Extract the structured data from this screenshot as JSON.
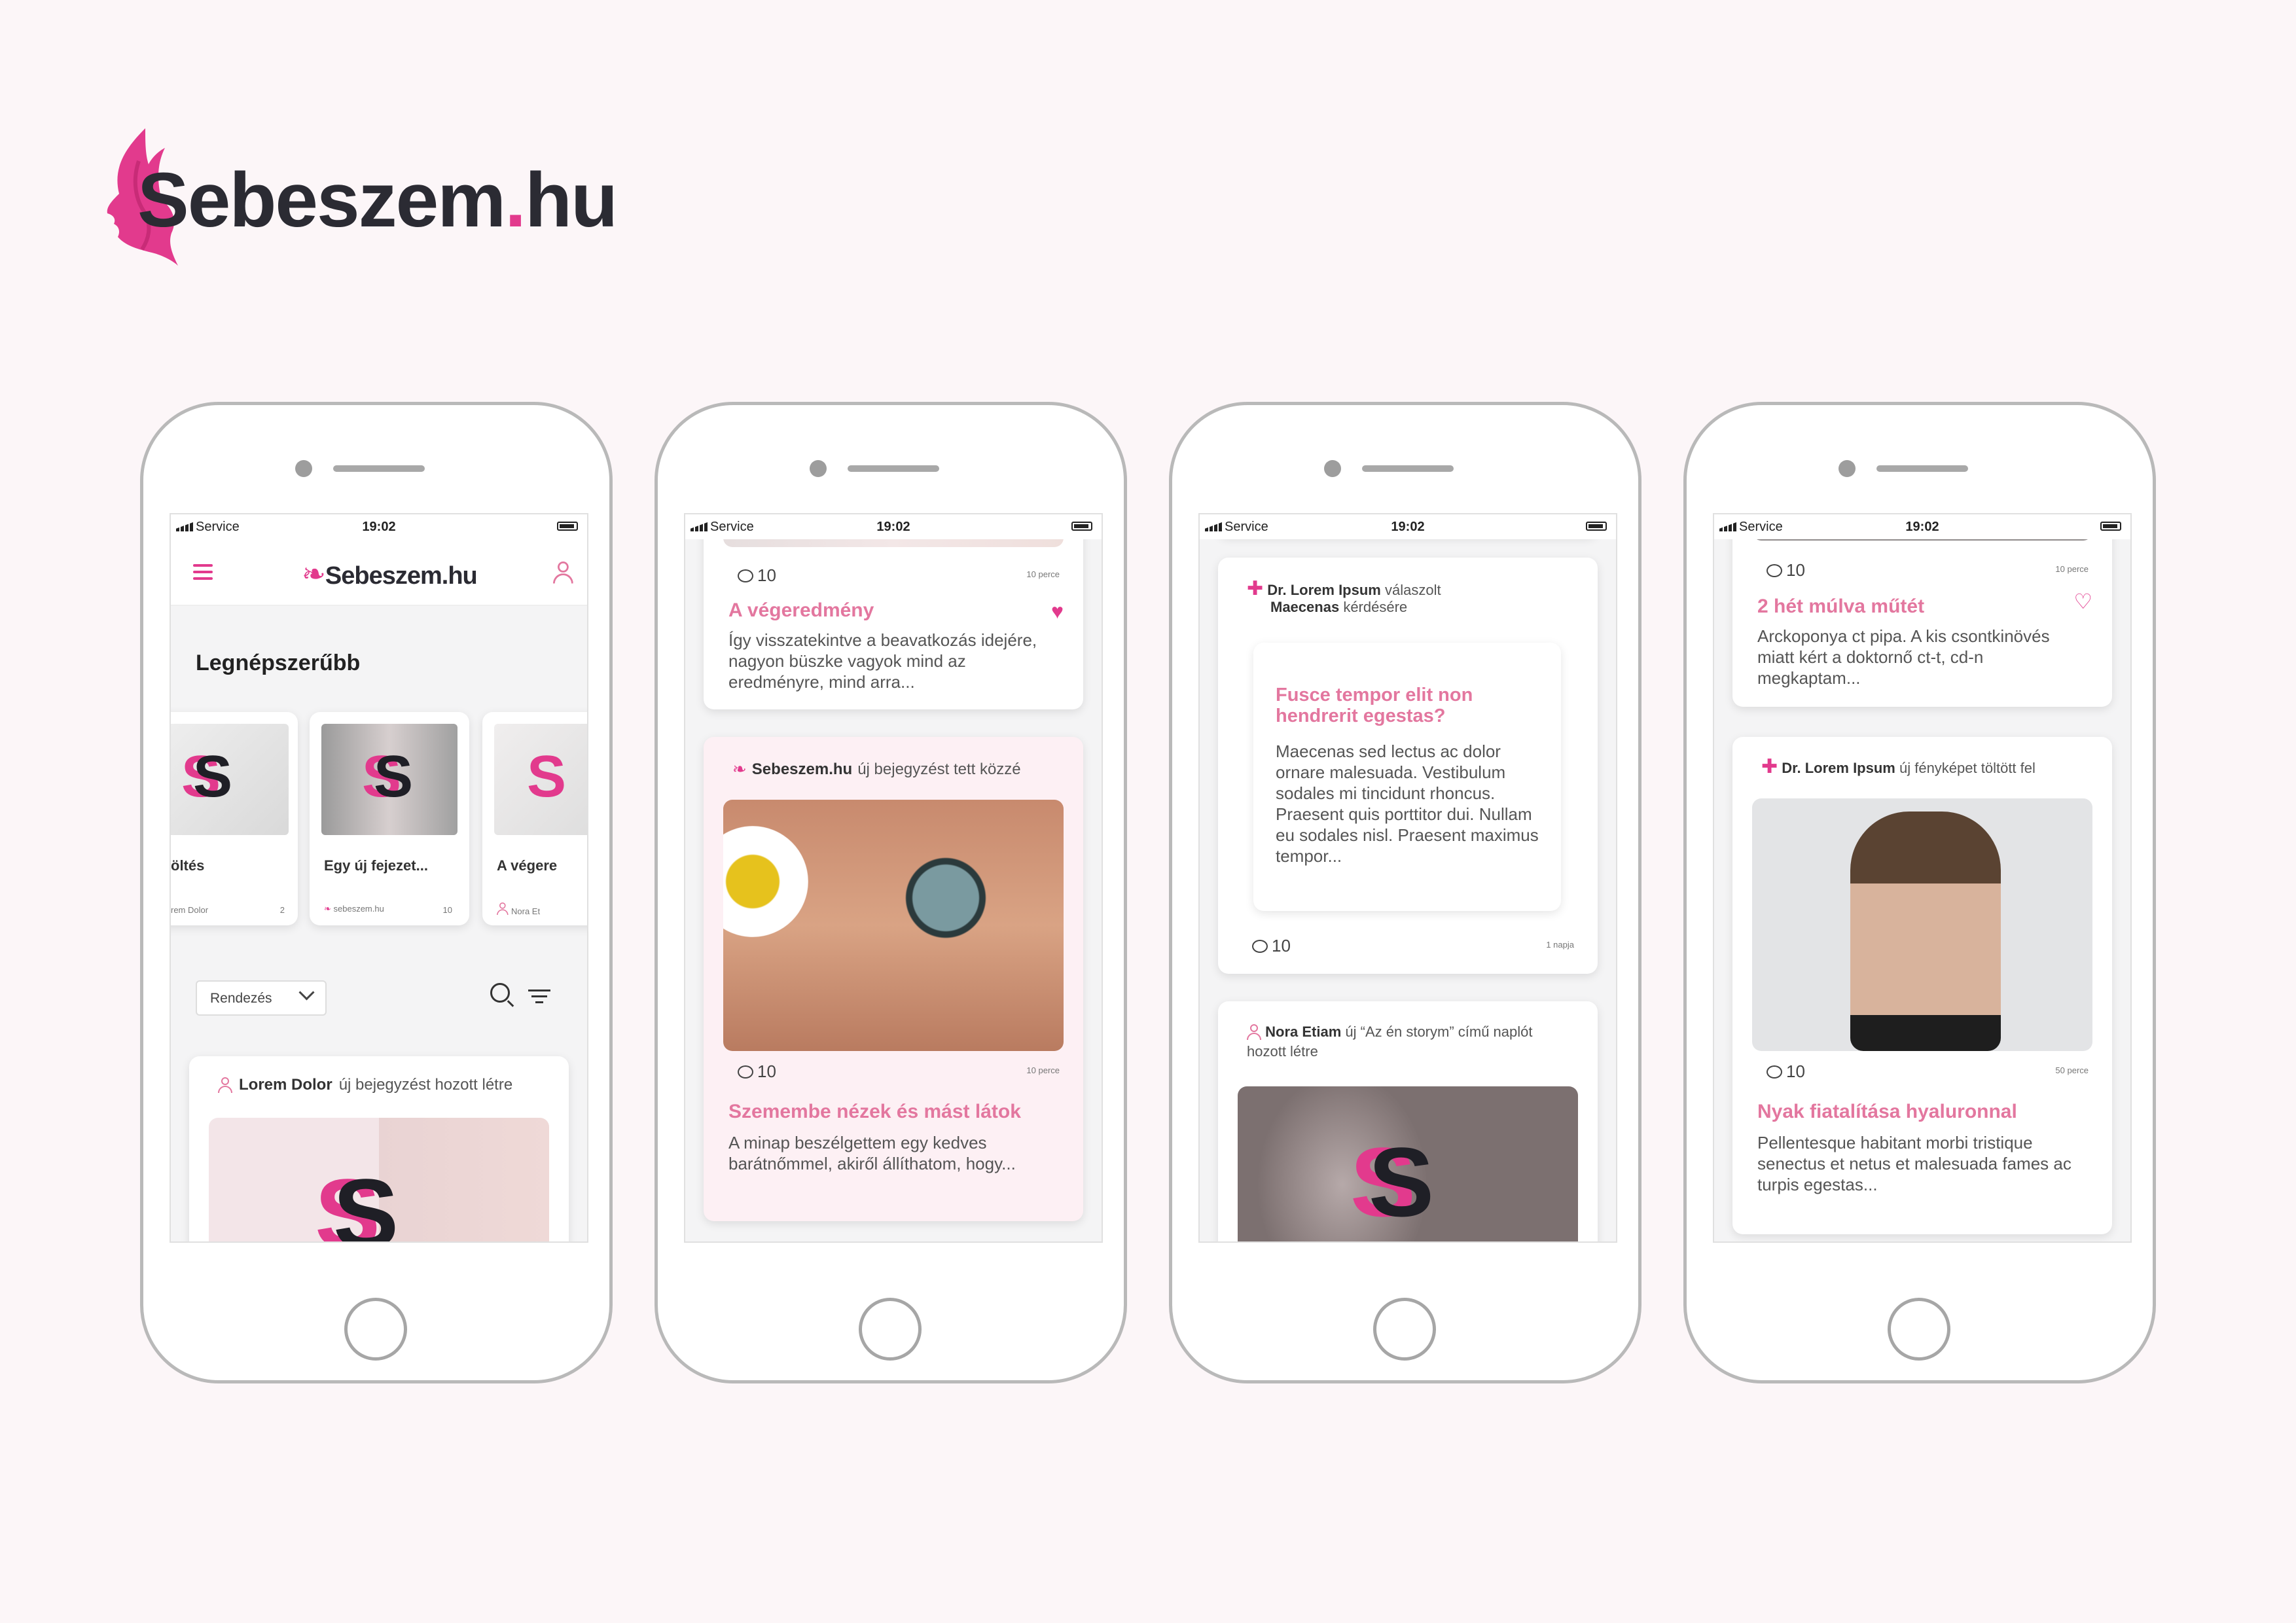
{
  "brand": {
    "name_main": "Sebeszem",
    "name_dot": ".",
    "name_tld": "hu"
  },
  "status_bar": {
    "carrier": "Service",
    "time": "19:02"
  },
  "screen1": {
    "header_logo": "Sebeszem.hu",
    "section_title": "Legnépszerűbb",
    "carousel": [
      {
        "title": "öltés",
        "author": "rem Dolor",
        "count": "2"
      },
      {
        "title": "Egy új fejezet...",
        "author": "sebeszem.hu",
        "count": "10"
      },
      {
        "title": "A végere",
        "author": "Nora Et",
        "count": ""
      }
    ],
    "sort_label": "Rendezés",
    "feed_meta_name": "Lorem  Dolor",
    "feed_meta_action": "új bejegyzést hozott létre"
  },
  "screen2": {
    "card1_comments": "10",
    "card1_time": "10 perce",
    "card1_title": "A végeredmény",
    "card1_body": "Így visszatekintve a beavatkozás idejére, nagyon büszke vagyok mind az eredményre, mind arra...",
    "card2_meta_name": "Sebeszem.hu",
    "card2_meta_action": "új bejegyzést tett közzé",
    "card2_comments": "10",
    "card2_time": "10 perce",
    "card2_title": "Szemembe nézek és mást látok",
    "card2_body": "A minap beszélgettem egy kedves barátnőmmel, akiről állíthatom, hogy..."
  },
  "screen3": {
    "card1_meta_name": "Dr. Lorem Ipsum",
    "card1_meta_action": "válaszolt",
    "card1_meta_name2": "Maecenas",
    "card1_meta_action2": "kérdésére",
    "quote_title": "Fusce tempor elit non hendrerit egestas?",
    "quote_body": "Maecenas sed lectus ac dolor ornare malesuada. Vestibulum sodales mi tincidunt rhoncus. Praesent quis porttitor dui. Nullam eu sodales nisl. Praesent maximus tempor...",
    "card1_comments": "10",
    "card1_time": "1 napja",
    "card2_meta_name": "Nora Etiam",
    "card2_meta_action": "új “Az én storym” című naplót hozott létre"
  },
  "screen4": {
    "card1_comments": "10",
    "card1_time": "10 perce",
    "card1_title": "2 hét múlva műtét",
    "card1_body": "Arckoponya ct pipa. A kis csontkinövés miatt kért a doktornő ct-t, cd-n megkaptam...",
    "card2_meta_name": "Dr. Lorem Ipsum",
    "card2_meta_action": "új fényképet töltött fel",
    "card2_comments": "10",
    "card2_time": "50 perce",
    "card2_title": "Nyak fiatalítása hyaluronnal",
    "card2_body": "Pellentesque habitant morbi tristique senectus et netus et malesuada fames ac turpis egestas..."
  },
  "colors": {
    "accent": "#e23a8d",
    "accent_soft": "#e3779f",
    "text_dark": "#2b2b33",
    "background": "#fcf6f8"
  }
}
